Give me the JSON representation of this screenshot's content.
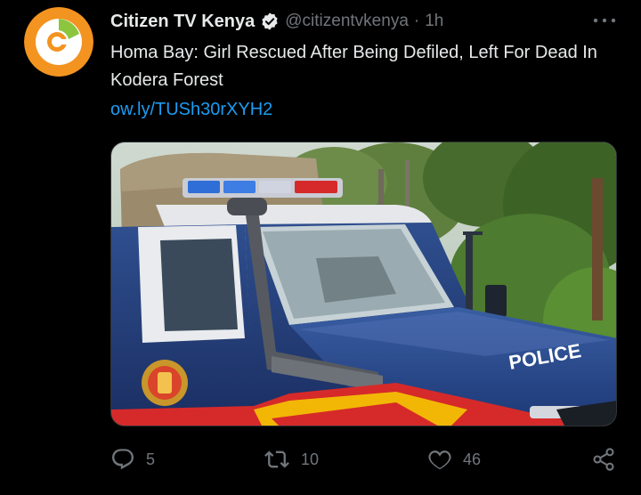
{
  "tweet": {
    "author": {
      "display_name": "Citizen TV Kenya",
      "handle": "@citizentvkenya",
      "verified": true
    },
    "separator": "·",
    "time": "1h",
    "text": "Homa Bay: Girl Rescued After Being Defiled, Left For Dead In Kodera Forest",
    "link": "ow.ly/TUSh30rXYH2",
    "media": {
      "vehicle_label": "POLICE"
    },
    "stats": {
      "replies": "5",
      "retweets": "10",
      "likes": "46"
    }
  },
  "colors": {
    "background": "#000000",
    "text_primary": "#e7e9ea",
    "text_secondary": "#71767b",
    "link": "#1d9bf0",
    "avatar_orange": "#f39320",
    "avatar_green": "#8cc63f",
    "police_blue": "#1e3a78"
  },
  "icons": {
    "avatar": "citizen-tv-logo",
    "verified": "verified-badge-icon",
    "more": "more-options-icon",
    "reply": "reply-icon",
    "retweet": "retweet-icon",
    "like": "heart-icon",
    "share": "share-icon"
  }
}
